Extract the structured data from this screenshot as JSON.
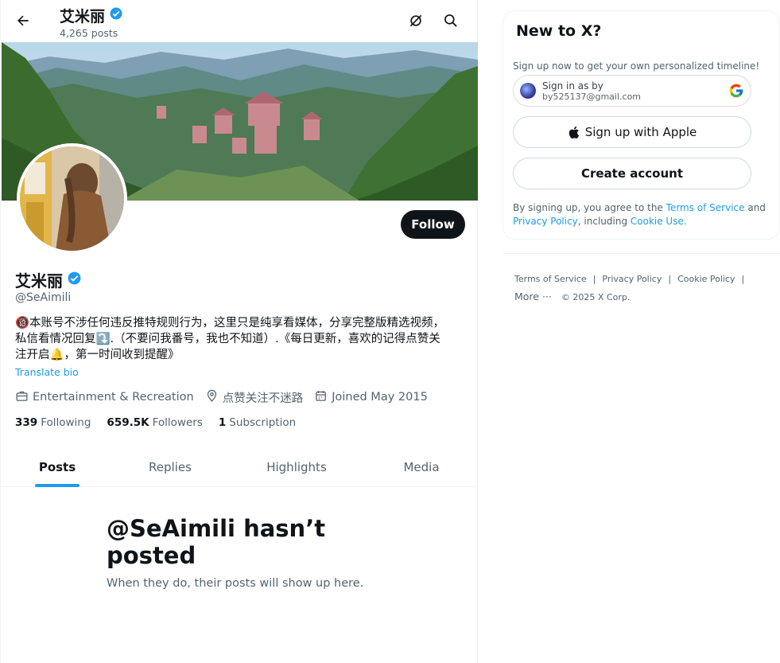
{
  "header": {
    "name": "艾米丽",
    "posts_count": "4,265 posts"
  },
  "profile": {
    "name": "艾米丽",
    "handle": "@SeAimili",
    "bio_line1": "🔞本账号不涉任何违反推特规则行为，这里只是纯享看媒体，分享完整版精选视频，",
    "bio_line2": "私信看情况回复⤵️.（不要问我番号，我也不知道）.《每日更新，喜欢的记得点赞关",
    "bio_line3": "注开启🔔，第一时间收到提醒》",
    "translate_label": "Translate bio",
    "category": "Entertainment & Recreation",
    "location": "点赞关注不迷路",
    "joined": "Joined May 2015",
    "follow_label": "Follow"
  },
  "stats": {
    "following_count": "339",
    "following_label": "Following",
    "followers_count": "659.5K",
    "followers_label": "Followers",
    "subscription_count": "1",
    "subscription_label": "Subscription"
  },
  "tabs": [
    {
      "label": "Posts"
    },
    {
      "label": "Replies"
    },
    {
      "label": "Highlights"
    },
    {
      "label": "Media"
    }
  ],
  "empty_state": {
    "title": "@SeAimili hasn’t posted",
    "subtitle": "When they do, their posts will show up here."
  },
  "signup": {
    "title": "New to X?",
    "subtitle": "Sign up now to get your own personalized timeline!",
    "google_line1": "Sign in as by",
    "google_line2": "by525137@gmail.com",
    "apple_label": "Sign up with Apple",
    "create_label": "Create account",
    "legal_prefix": "By signing up, you agree to the ",
    "legal_tos": "Terms of Service",
    "legal_and": " and ",
    "legal_privacy": "Privacy Policy",
    "legal_including": ", including ",
    "legal_cookie": "Cookie Use."
  },
  "footer": {
    "links": [
      "Terms of Service",
      "Privacy Policy",
      "Cookie Policy"
    ],
    "more": "More ···",
    "copyright": "© 2025 X Corp."
  },
  "colors": {
    "accent": "#1d9bf0",
    "text": "#0f1419",
    "muted": "#536471"
  }
}
